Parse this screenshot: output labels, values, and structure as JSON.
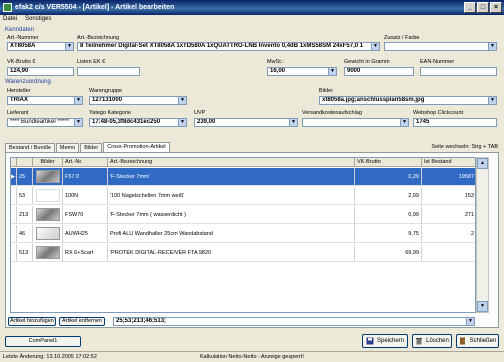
{
  "window": {
    "title": "efak2 c/s VER5504 - [Artikel] - Artikel bearbeiten",
    "buttons": [
      "_",
      "□",
      "×"
    ]
  },
  "menu": {
    "items": [
      "Datei",
      "Sonstiges"
    ]
  },
  "sections": {
    "kenndaten": "Kenndaten",
    "warenzuordnung": "Warenzuordnung"
  },
  "fields": {
    "artnr_label": "Art.-Nummer",
    "artnr": "XT8058A",
    "bezeichnung_label": "Art.-Bezeichnung",
    "bezeichnung": "8 Teilnehmer Digital-Set XT8058A 1xTD580A 1xQUATTRO-LNB Invento 0,4dB 1xMS58SM 24xF57,0 1",
    "zusatz_label": "Zusatz / Farbe",
    "zusatz": "",
    "vk_label": "VK-Brutto €",
    "vk": "124,90",
    "listen_label": "Listen EK €",
    "listen": "",
    "mwst_label": "MwSt.:",
    "mwst": "16,00",
    "gewicht_label": "Gewicht in Gramm",
    "gewicht": "9000",
    "ean_label": "EAN-Nummer",
    "ean": "",
    "hersteller_label": "Hersteller",
    "hersteller": "TRIAX",
    "warengruppe_label": "Warengruppe",
    "warengruppe": "127131000",
    "bilder_label": "Bilder",
    "bilder": "xt8058a.jpg;anschlussplan58sm.jpg",
    "lieferant_label": "Lieferant",
    "lieferant": "**** Bundleartikel *****",
    "yatego_label": "Yatego Kategorie",
    "yatego": "17:48-05,3f8dc431ec250",
    "uvp_label": "UVP",
    "uvp": "239,00",
    "versand_label": "Versandkostenaufschlag",
    "versand": "",
    "webshop_label": "Webshop Clickcount",
    "webshop": "1745"
  },
  "tabs": [
    {
      "label": "Bestand / Bundle",
      "active": false
    },
    {
      "label": "Memo",
      "active": false
    },
    {
      "label": "Bilder",
      "active": false
    },
    {
      "label": "Cross-Promotion-Artikel",
      "active": true
    }
  ],
  "hint": "Seite wechseln: Strg + TAB",
  "table": {
    "headers": [
      "",
      "",
      "Bilder",
      "Art.-Nr.",
      "Art.-Bezeichnung",
      "VK-Brutto",
      "Ist Bestand"
    ],
    "rows": [
      {
        "id": "25",
        "img": "dark",
        "artnr": "F57.0",
        "bez": "'F-Stecker 7mm'",
        "vk": "0,29",
        "bestand": "19587",
        "selected": true
      },
      {
        "id": "53",
        "img": "blank",
        "artnr": "100N",
        "bez": "'100 Nagelschellen 7mm weiß'",
        "vk": "2,99",
        "bestand": "153",
        "selected": false
      },
      {
        "id": "213",
        "img": "dark",
        "artnr": "FSW70",
        "bez": "'F-Stecker 7mm ( wasserdicht )",
        "vk": "0,99",
        "bestand": "271",
        "selected": false
      },
      {
        "id": "46",
        "img": "light",
        "artnr": "AUWH25",
        "bez": "Profi ALU Wandhalter 25cm Wandabstand",
        "vk": "9,75",
        "bestand": "2",
        "selected": false
      },
      {
        "id": "513",
        "img": "dark",
        "artnr": "RX 6+Scart",
        "bez": "'PROTEK DIGITAL-RECEIVER FTA 9820",
        "vk": "69,99",
        "bestand": "",
        "selected": false
      }
    ]
  },
  "bottom": {
    "add_button": "Artikel hinzufügen",
    "remove_button": "Artikel entfernen",
    "ids": "25;53;213;46;513;",
    "companel": "ComPanel1"
  },
  "actions": {
    "save": "Speichern",
    "delete": "Löschen",
    "close": "Schließen"
  },
  "status": {
    "left": "Letzte Änderung: 13.10.2005 17:02:52",
    "center": "Kalkulation Netto-Netto : Anzeige gesperrt!"
  },
  "colors": {
    "titlebar": "#0a246a",
    "selection": "#316ac5",
    "group_label": "#2040a0"
  }
}
